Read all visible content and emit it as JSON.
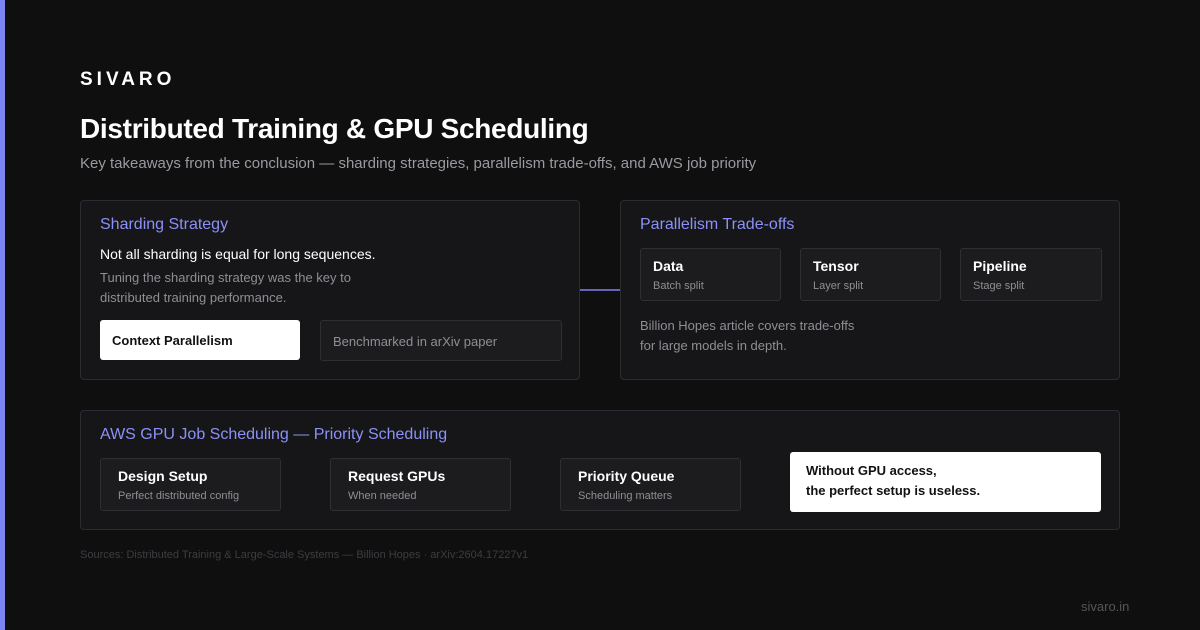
{
  "brand": "SIVARO",
  "title": "Distributed Training & GPU Scheduling",
  "subtitle": "Key takeaways from the conclusion — sharding strategies, parallelism trade-offs, and AWS job priority",
  "sharding": {
    "heading": "Sharding Strategy",
    "statement": "Not all sharding is equal for long sequences.",
    "detail_line1": "Tuning the sharding strategy was the key to",
    "detail_line2": "distributed training performance.",
    "primary_pill": "Context Parallelism",
    "secondary_pill": "Benchmarked in arXiv paper"
  },
  "parallelism": {
    "heading": "Parallelism Trade-offs",
    "items": [
      {
        "title": "Data",
        "sub": "Batch split"
      },
      {
        "title": "Tensor",
        "sub": "Layer split"
      },
      {
        "title": "Pipeline",
        "sub": "Stage split"
      }
    ],
    "note_line1": "Billion Hopes article covers trade-offs",
    "note_line2": "for large models in depth."
  },
  "scheduling": {
    "heading": "AWS GPU Job Scheduling — Priority Scheduling",
    "steps": [
      {
        "title": "Design Setup",
        "sub": "Perfect distributed config"
      },
      {
        "title": "Request GPUs",
        "sub": "When needed"
      },
      {
        "title": "Priority Queue",
        "sub": "Scheduling matters"
      }
    ],
    "conclusion_line1": "Without GPU access,",
    "conclusion_line2": "the perfect setup is useless."
  },
  "sources": "Sources: Distributed Training & Large-Scale Systems — Billion Hopes · arXiv:2604.17227v1",
  "footer": "sivaro.in",
  "colors": {
    "accent": "#7c83f2",
    "heading": "#8b91f6",
    "background": "#0f0f10",
    "card": "#161618"
  }
}
